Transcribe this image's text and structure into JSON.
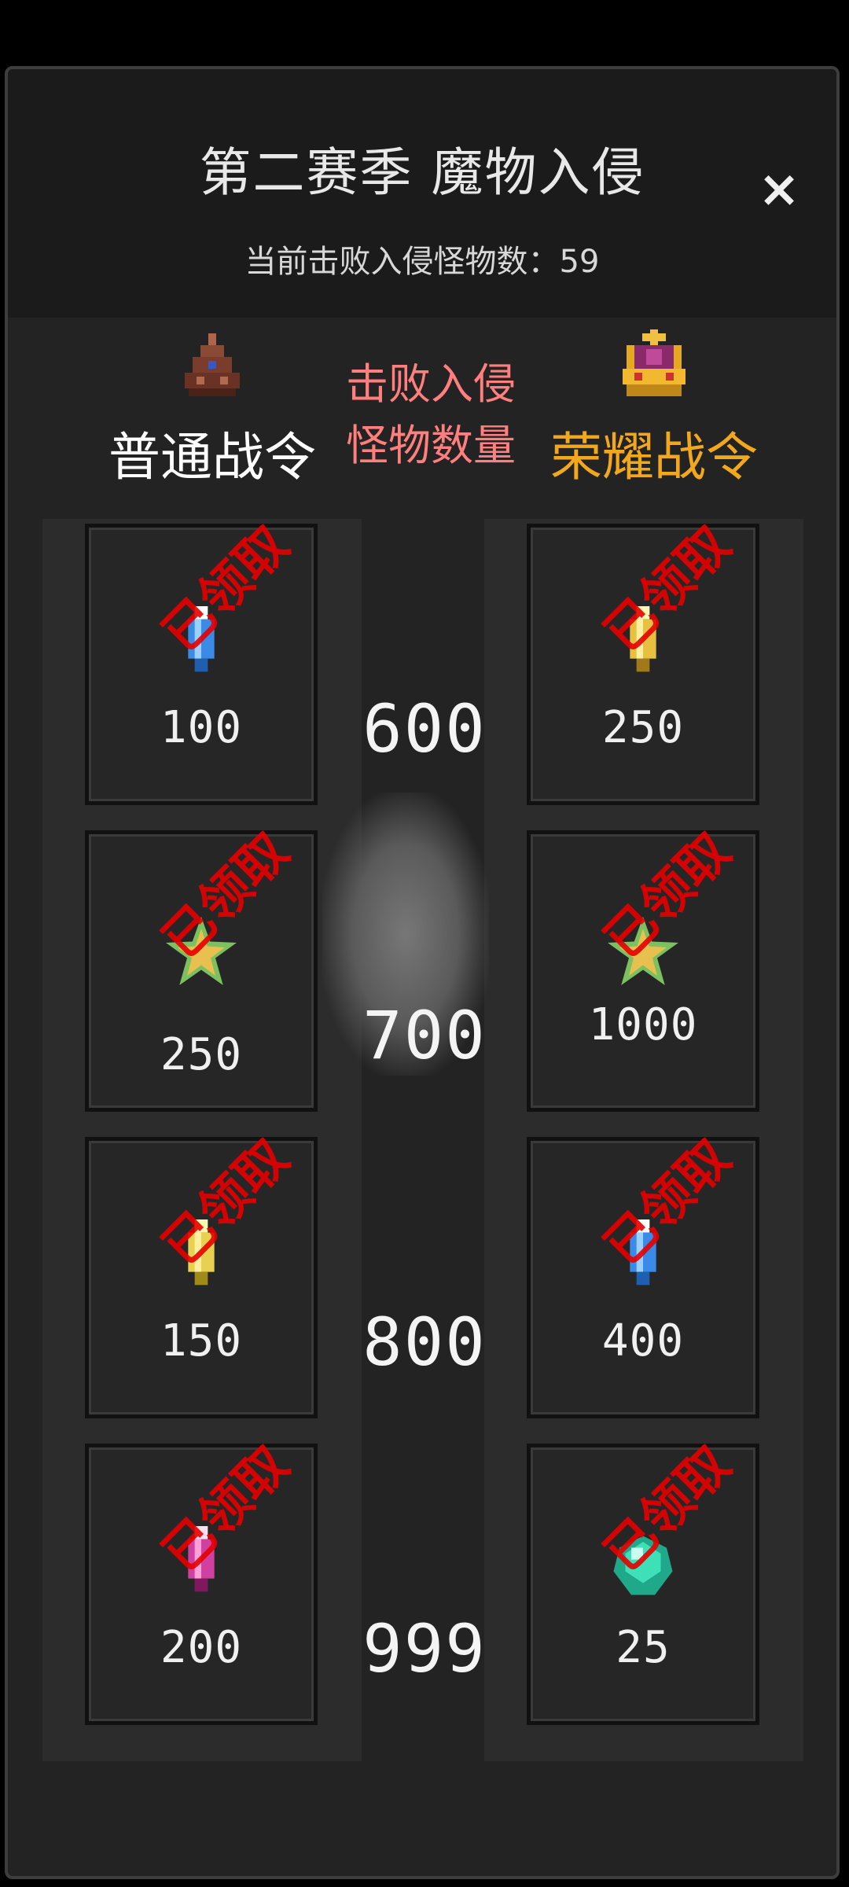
{
  "title": "第二赛季 魔物入侵",
  "close_label": "×",
  "defeated_text": "当前击败入侵怪物数：59",
  "columns": {
    "normal_label": "普通战令",
    "middle_label_line1": "击败入侵",
    "middle_label_line2": "怪物数量",
    "glory_label": "荣耀战令"
  },
  "claimed_stamp": "已领取",
  "tiers": [
    {
      "count": "600",
      "normal": {
        "qty": "100",
        "icon": "blue-crystal-icon"
      },
      "glory": {
        "qty": "250",
        "icon": "gold-crystal-icon"
      }
    },
    {
      "count": "700",
      "normal": {
        "qty": "250",
        "icon": "star-icon"
      },
      "glory": {
        "qty": "1000",
        "icon": "star-icon"
      }
    },
    {
      "count": "800",
      "normal": {
        "qty": "150",
        "icon": "gold-crystal-icon"
      },
      "glory": {
        "qty": "400",
        "icon": "blue-crystal-icon"
      }
    },
    {
      "count": "999",
      "normal": {
        "qty": "200",
        "icon": "pink-crystal-icon"
      },
      "glory": {
        "qty": "25",
        "icon": "green-gem-icon"
      }
    }
  ],
  "colors": {
    "normal_label": "#ffffff",
    "glory_label": "#f2a81d",
    "middle_label": "#ff7f7f",
    "claimed_stamp": "#e60000"
  }
}
